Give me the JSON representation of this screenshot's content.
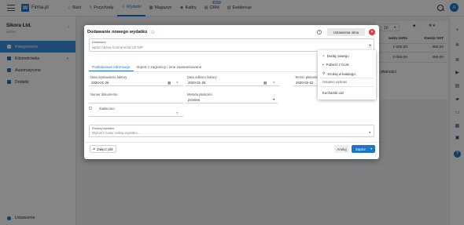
{
  "app": {
    "name": "Firma.pl",
    "logo_letter": "W"
  },
  "nav": [
    {
      "label": "Start",
      "icon": "home-icon",
      "glyph": "⌂"
    },
    {
      "label": "Przychody",
      "icon": "upload-icon",
      "glyph": "⇧"
    },
    {
      "label": "Wydatki",
      "icon": "download-icon",
      "glyph": "⇩",
      "active": true
    },
    {
      "label": "Magazyn",
      "icon": "warehouse-icon",
      "glyph": "▦"
    },
    {
      "label": "Kadry",
      "icon": "people-icon",
      "glyph": "☻"
    },
    {
      "label": "CRM",
      "icon": "crm-icon",
      "glyph": "▤",
      "badge": "BETA"
    },
    {
      "label": "Ewidencje",
      "icon": "register-icon",
      "glyph": "▥"
    }
  ],
  "user": {
    "initial": "A"
  },
  "sidebar": {
    "company": "Sikora Ltd.",
    "role": "admin",
    "items": [
      {
        "label": "Księgowanie",
        "active": true
      },
      {
        "label": "Kilometrówka",
        "arrow": "▼"
      },
      {
        "label": "Automatyczne"
      },
      {
        "label": "Dodatki"
      }
    ],
    "settings_label": "Ustawienia"
  },
  "background": {
    "page_size": "10",
    "col_netto": "wota netto",
    "col_vat": "Kwota VAT",
    "row1": [
      "2 000,00",
      "460,00"
    ],
    "row2": [
      "2 000,00",
      "460,00"
    ],
    "row3_text": "płatności"
  },
  "modal": {
    "title": "Dodawanie nowego wydatku",
    "settings_button": "Ustawienia okna",
    "contractor_label": "Dostawca",
    "contractor_placeholder": "wpisz nazwę kontrahenta lub NIP",
    "tabs": [
      "Podstawowe informacje",
      "Import z zagranicy i inne zaawansowane"
    ],
    "invoice_date_label": "Data wystawienia faktury",
    "invoice_date": "2020-01-26",
    "receipt_date_label": "Data odbioru faktury",
    "receipt_date": "2020-01-26",
    "payment_due_label": "Termin płatności",
    "payment_due": "2020-02-02",
    "doc_number_label": "Numer dokumentu",
    "payment_method_label": "Metoda płatności",
    "payment_method": "przelew",
    "paid_label": "Zapłacono",
    "expense_type_label": "Rodzaj wydatku",
    "expense_type_placeholder": "Wybierz nowy rodzaj wydatku...",
    "attach_button": "Załącz plik",
    "cancel_button": "Anuluj",
    "save_button": "Zapisz"
  },
  "dropdown": {
    "items": [
      {
        "label": "Dodaj nowego",
        "glyph": "+"
      },
      {
        "label": "Pobierz z GUS",
        "glyph": "▪"
      },
      {
        "label": "Szukaj w katalogu",
        "glyph": "⚲"
      }
    ],
    "recent_label": "Ostatnio wybrani",
    "recent_item": "Kucharski Ltd"
  }
}
